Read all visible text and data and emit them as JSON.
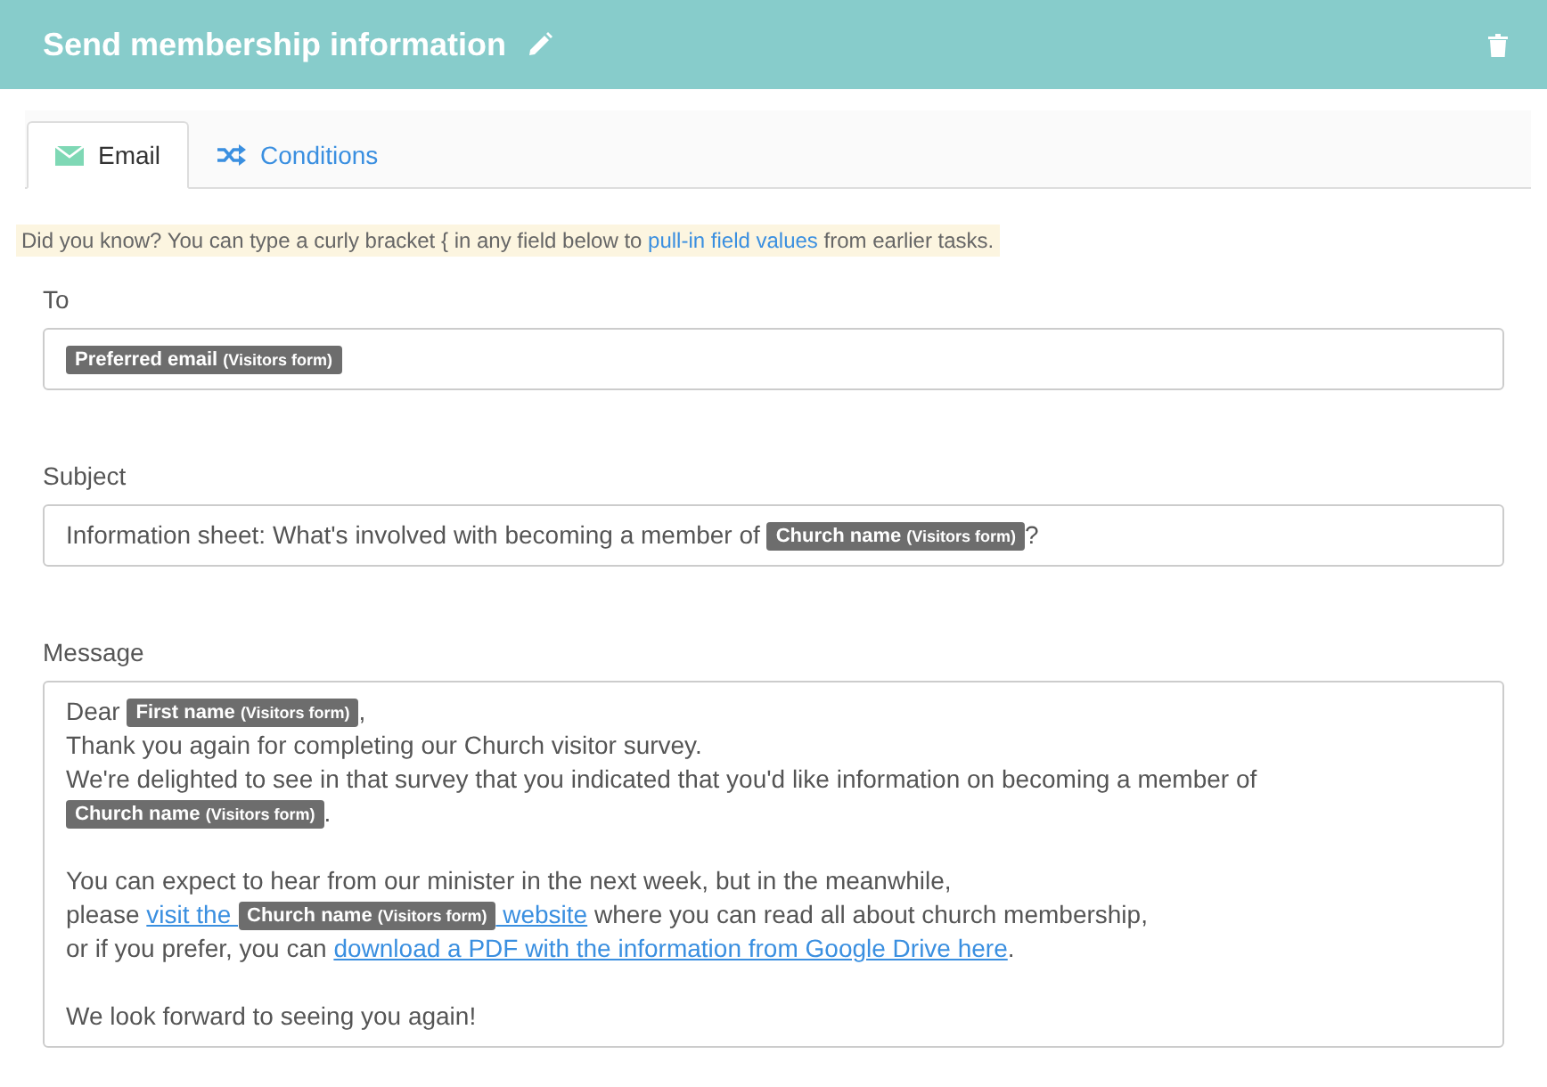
{
  "header": {
    "title": "Send membership information"
  },
  "tabs": [
    {
      "label": "Email",
      "kind": "email",
      "selected": true
    },
    {
      "label": "Conditions",
      "kind": "conditions",
      "selected": false
    }
  ],
  "hint": {
    "before": "Did you know? You can type a curly bracket { in any field below to ",
    "link": "pull-in field values",
    "after": " from earlier tasks."
  },
  "fields": [
    {
      "label": "To",
      "lines": [
        {
          "paragraph_break": false,
          "segments": [
            {
              "kind": "token",
              "name": "Preferred email",
              "source": "(Visitors form)"
            }
          ]
        }
      ]
    },
    {
      "label": "Subject",
      "lines": [
        {
          "paragraph_break": false,
          "segments": [
            {
              "kind": "text",
              "text": "Information sheet: What's involved with becoming a member of "
            },
            {
              "kind": "token",
              "name": "Church name",
              "source": "(Visitors form)"
            },
            {
              "kind": "text",
              "text": "?"
            }
          ]
        }
      ]
    },
    {
      "label": "Message",
      "lines": [
        {
          "paragraph_break": false,
          "segments": [
            {
              "kind": "text",
              "text": "Dear "
            },
            {
              "kind": "token",
              "name": "First name",
              "source": "(Visitors form)"
            },
            {
              "kind": "text",
              "text": ","
            }
          ]
        },
        {
          "paragraph_break": false,
          "segments": [
            {
              "kind": "text",
              "text": "Thank you again for completing our Church visitor survey."
            }
          ]
        },
        {
          "paragraph_break": false,
          "segments": [
            {
              "kind": "text",
              "text": "We're delighted to see in that survey that you indicated that you'd like information on becoming a member of"
            }
          ]
        },
        {
          "paragraph_break": false,
          "segments": [
            {
              "kind": "token",
              "name": "Church name",
              "source": "(Visitors form)"
            },
            {
              "kind": "text",
              "text": "."
            }
          ]
        },
        {
          "paragraph_break": true,
          "segments": [
            {
              "kind": "text",
              "text": "You can expect to hear from our minister in the next week, but in the meanwhile,"
            }
          ]
        },
        {
          "paragraph_break": false,
          "segments": [
            {
              "kind": "text",
              "text": "please "
            },
            {
              "kind": "link",
              "parts": [
                {
                  "kind": "text",
                  "text": "visit the "
                },
                {
                  "kind": "token",
                  "name": "Church name",
                  "source": "(Visitors form)"
                },
                {
                  "kind": "text",
                  "text": " website"
                }
              ]
            },
            {
              "kind": "text",
              "text": " where you can read all about church membership,"
            }
          ]
        },
        {
          "paragraph_break": false,
          "segments": [
            {
              "kind": "text",
              "text": "or if you prefer, you can "
            },
            {
              "kind": "link",
              "parts": [
                {
                  "kind": "text",
                  "text": "download a PDF with the information from Google Drive here"
                }
              ]
            },
            {
              "kind": "text",
              "text": "."
            }
          ]
        },
        {
          "paragraph_break": true,
          "segments": [
            {
              "kind": "text",
              "text": "We look forward to seeing you again!"
            }
          ]
        }
      ]
    }
  ]
}
